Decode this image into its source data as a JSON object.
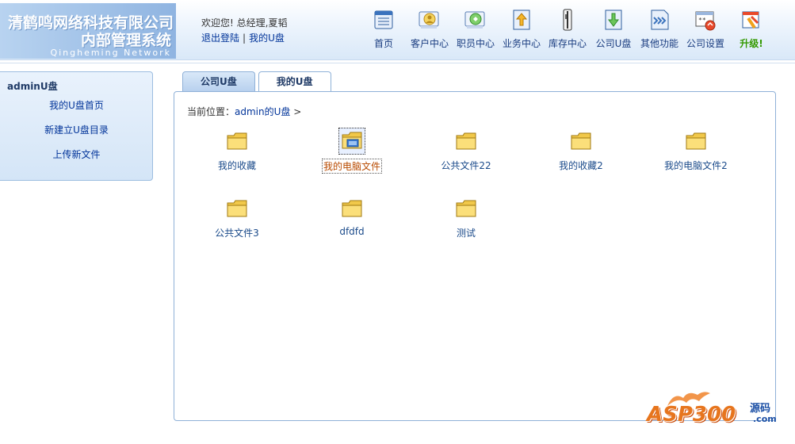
{
  "header": {
    "logo_line1": "清鹤鸣网络科技有限公司",
    "logo_line2": "内部管理系统",
    "logo_en": "Qingheming Network",
    "welcome_prefix": "欢迎您! 总经理,",
    "user_name": "夏韬",
    "logout_label": "退出登陆",
    "my_udisk_label": "我的U盘"
  },
  "nav": [
    {
      "label": "首页",
      "icon": "home-icon"
    },
    {
      "label": "客户中心",
      "icon": "customer-icon"
    },
    {
      "label": "职员中心",
      "icon": "staff-icon"
    },
    {
      "label": "业务中心",
      "icon": "business-icon"
    },
    {
      "label": "库存中心",
      "icon": "inventory-icon"
    },
    {
      "label": "公司U盘",
      "icon": "udisk-icon"
    },
    {
      "label": "其他功能",
      "icon": "other-icon"
    },
    {
      "label": "公司设置",
      "icon": "settings-icon"
    },
    {
      "label": "升级!",
      "icon": "upgrade-icon"
    }
  ],
  "sidebar": {
    "title": "adminU盘",
    "items": [
      {
        "label": "我的U盘首页"
      },
      {
        "label": "新建立U盘目录"
      },
      {
        "label": "上传新文件"
      }
    ]
  },
  "tabs": [
    {
      "label": "公司U盘",
      "active": false
    },
    {
      "label": "我的U盘",
      "active": true
    }
  ],
  "breadcrumb": {
    "prefix": "当前位置：",
    "crumb": "admin的U盘",
    "sep": ">"
  },
  "folders": [
    {
      "label": "我的收藏",
      "type": "folder"
    },
    {
      "label": "我的电脑文件",
      "type": "folder-shared",
      "selected": true
    },
    {
      "label": "公共文件22",
      "type": "folder"
    },
    {
      "label": "我的收藏2",
      "type": "folder"
    },
    {
      "label": "我的电脑文件2",
      "type": "folder"
    },
    {
      "label": "公共文件3",
      "type": "folder"
    },
    {
      "label": "dfdfd",
      "type": "folder"
    },
    {
      "label": "测试",
      "type": "folder"
    }
  ],
  "watermark": {
    "text": "ASP300",
    "cn": "源码",
    "com": ".com"
  },
  "colors": {
    "accent": "#8fb1d8",
    "link": "#003399",
    "upgrade": "#339900",
    "watermark": "#e7751d"
  }
}
